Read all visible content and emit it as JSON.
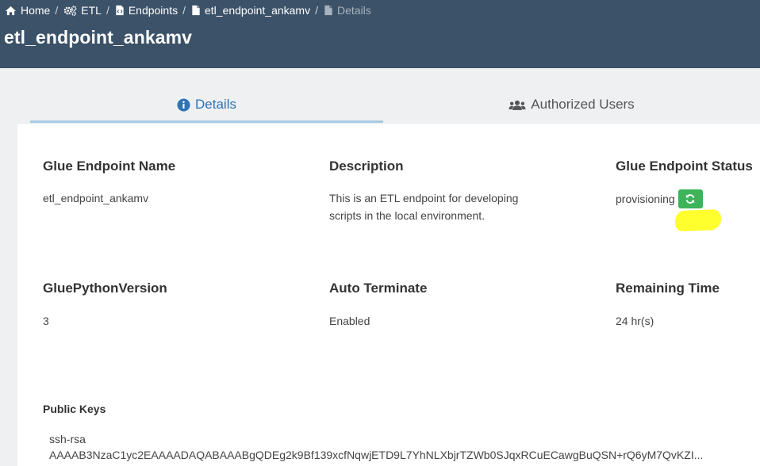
{
  "breadcrumb": {
    "items": [
      {
        "label": "Home",
        "icon": "home-icon"
      },
      {
        "label": "ETL",
        "icon": "gears-icon"
      },
      {
        "label": "Endpoints",
        "icon": "code-file-icon"
      },
      {
        "label": "etl_endpoint_ankamv",
        "icon": "file-icon"
      },
      {
        "label": "Details",
        "icon": "file-icon"
      }
    ],
    "separator": "/"
  },
  "page": {
    "title": "etl_endpoint_ankamv"
  },
  "tabs": [
    {
      "label": "Details",
      "icon": "info-circle-icon",
      "active": true
    },
    {
      "label": "Authorized Users",
      "icon": "users-icon",
      "active": false
    }
  ],
  "details": {
    "name": {
      "label": "Glue Endpoint Name",
      "value": "etl_endpoint_ankamv"
    },
    "description": {
      "label": "Description",
      "line1": "This is an ETL endpoint for developing",
      "line2": "scripts in the local environment."
    },
    "status": {
      "label": "Glue Endpoint Status",
      "value": "provisioning",
      "refresh_icon": "refresh-icon"
    },
    "python_version": {
      "label": "GluePythonVersion",
      "value": "3"
    },
    "auto_terminate": {
      "label": "Auto Terminate",
      "value": "Enabled"
    },
    "remaining_time": {
      "label": "Remaining Time",
      "value": "24 hr(s)"
    },
    "public_keys": {
      "label": "Public Keys",
      "line1": "ssh-rsa",
      "line2": "AAAAB3NzaC1yc2EAAAADAQABAAABgQDEg2k9Bf139xcfNqwjETD9L7YhNLXbjrTZWb0SJqxRCuECawgBuQSN+rQ6yM7QvKZI..."
    }
  },
  "colors": {
    "header_bg": "#3c5268",
    "accent": "#2f73b4",
    "refresh_button": "#3db35a",
    "highlight": "#ffff2e"
  }
}
